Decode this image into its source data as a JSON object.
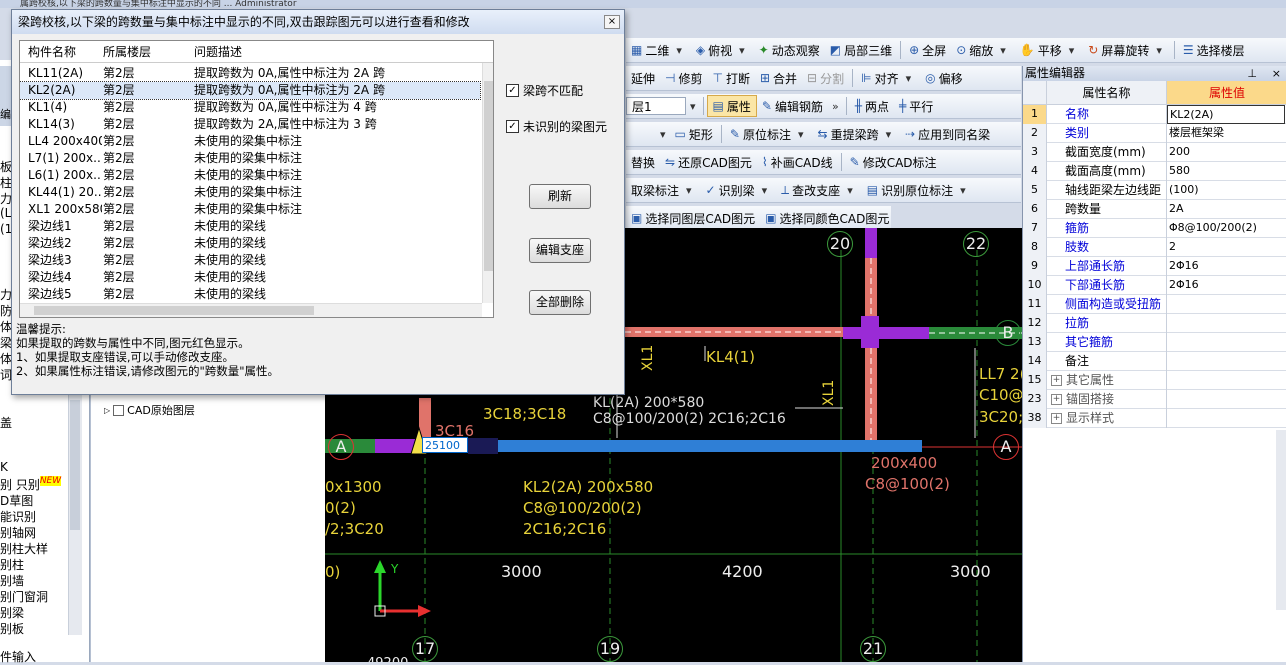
{
  "top_strip": {
    "title": "属跨校核,以下梁的跨数量与集中标注中显示的不同 ... Administrator"
  },
  "toolbar1": {
    "items": [
      "二维",
      "俯视",
      "动态观察",
      "局部三维",
      "全屏",
      "缩放",
      "平移",
      "屏幕旋转",
      "选择楼层"
    ]
  },
  "toolbar2": {
    "items": [
      "延伸",
      "修剪",
      "打断",
      "合并",
      "分割",
      "对齐",
      "偏移"
    ]
  },
  "toolbar3": {
    "floor_select": "层1",
    "items": [
      "属性",
      "编辑钢筋",
      "两点",
      "平行"
    ]
  },
  "toolbar4": {
    "items": [
      "矩形",
      "原位标注",
      "重提梁跨",
      "应用到同名梁"
    ]
  },
  "toolbar5": {
    "items": [
      "替换",
      "还原CAD图元",
      "补画CAD线",
      "修改CAD标注"
    ]
  },
  "toolbar6": {
    "items": [
      "取梁标注",
      "识别梁",
      "查改支座",
      "识别原位标注"
    ]
  },
  "toolbar7": {
    "items": [
      "选择同图层CAD图元",
      "选择同颜色CAD图元"
    ]
  },
  "left_panel": {
    "items": [
      "板",
      "柱",
      "力",
      "(L",
      "(1",
      "力",
      "防",
      "体",
      "梁",
      "体",
      "词",
      "盖",
      "K",
      "别 只别",
      "D草图",
      "能识别",
      "别轴网",
      "别柱大样",
      "别柱",
      "别墙",
      "别门窗洞",
      "别梁",
      "别板",
      "件输入"
    ],
    "new_badge": "NEW",
    "tree_item": "CAD原始图层",
    "edit_tab": "编"
  },
  "dialog": {
    "title": "梁跨校核,以下梁的跨数量与集中标注中显示的不同,双击跟踪图元可以进行查看和修改",
    "columns": [
      "构件名称",
      "所属楼层",
      "问题描述"
    ],
    "rows": [
      {
        "name": "KL11(2A)",
        "floor": "第2层",
        "desc": "提取跨数为 0A,属性中标注为 2A 跨"
      },
      {
        "name": "KL2(2A)",
        "floor": "第2层",
        "desc": "提取跨数为 0A,属性中标注为 2A 跨"
      },
      {
        "name": "KL1(4)",
        "floor": "第2层",
        "desc": "提取跨数为 0A,属性中标注为 4 跨"
      },
      {
        "name": "KL14(3)",
        "floor": "第2层",
        "desc": "提取跨数为 2A,属性中标注为 3 跨"
      },
      {
        "name": "LL4 200x400",
        "floor": "第2层",
        "desc": "未使用的梁集中标注"
      },
      {
        "name": "L7(1) 200x...",
        "floor": "第2层",
        "desc": "未使用的梁集中标注"
      },
      {
        "name": "L6(1) 200x...",
        "floor": "第2层",
        "desc": "未使用的梁集中标注"
      },
      {
        "name": "KL44(1) 20...",
        "floor": "第2层",
        "desc": "未使用的梁集中标注"
      },
      {
        "name": "XL1 200x580",
        "floor": "第2层",
        "desc": "未使用的梁集中标注"
      },
      {
        "name": "梁边线1",
        "floor": "第2层",
        "desc": "未使用的梁线"
      },
      {
        "name": "梁边线2",
        "floor": "第2层",
        "desc": "未使用的梁线"
      },
      {
        "name": "梁边线3",
        "floor": "第2层",
        "desc": "未使用的梁线"
      },
      {
        "name": "梁边线4",
        "floor": "第2层",
        "desc": "未使用的梁线"
      },
      {
        "name": "梁边线5",
        "floor": "第2层",
        "desc": "未使用的梁线"
      }
    ],
    "check_mismatch": "梁跨不匹配",
    "check_unrecognized": "未识别的梁图元",
    "btn_refresh": "刷新",
    "btn_edit_support": "编辑支座",
    "btn_delete_all": "全部删除",
    "tips": [
      "温馨提示:",
      "如果提取的跨数与属性中不同,图元红色显示。",
      "1、如果提取支座错误,可以手动修改支座。",
      "2、如果属性标注错误,请修改图元的\"跨数量\"属性。"
    ]
  },
  "canvas": {
    "grid_top": [
      "20",
      "22"
    ],
    "grid_bottom": [
      "17",
      "19",
      "21"
    ],
    "axis_letters": [
      "A",
      "A",
      "B"
    ],
    "dims": [
      "3000",
      "4200",
      "3000"
    ],
    "labels": {
      "kl4": "KL4(1)",
      "xl1a": "XL1",
      "xl1b": "XL1",
      "c18": "3C18;3C18",
      "c16": "3C16",
      "kl2_a": "KL(2A) 200*580",
      "kl2_b": "C8@100/200(2) 2C16;2C16",
      "input": "25100",
      "kl2_main1": "KL2(2A) 200x580",
      "kl2_main2": "C8@100/200(2)",
      "kl2_main3": "2C16;2C16",
      "left1": "0x1300",
      "left2": "0(2)",
      "left3": "/2;3C20",
      "left4": "0)",
      "b1": "200x400",
      "b2": "C8@100(2)",
      "ll7a": "LL7 2(",
      "ll7b": "C10@",
      "ll7c": "3C20;",
      "bottom_dim": "49200",
      "y_axis": "Y"
    }
  },
  "props": {
    "title": "属性编辑器",
    "header_name": "属性名称",
    "header_value": "属性值",
    "rows": [
      {
        "no": "1",
        "name": "名称",
        "value": "KL2(2A)",
        "blue": true
      },
      {
        "no": "2",
        "name": "类别",
        "value": "楼层框架梁",
        "blue": true
      },
      {
        "no": "3",
        "name": "截面宽度(mm)",
        "value": "200",
        "blue": false
      },
      {
        "no": "4",
        "name": "截面高度(mm)",
        "value": "580",
        "blue": false
      },
      {
        "no": "5",
        "name": "轴线距梁左边线距",
        "value": "(100)",
        "blue": false
      },
      {
        "no": "6",
        "name": "跨数量",
        "value": "2A",
        "blue": false
      },
      {
        "no": "7",
        "name": "箍筋",
        "value": "Φ8@100/200(2)",
        "blue": true
      },
      {
        "no": "8",
        "name": "肢数",
        "value": "2",
        "blue": true
      },
      {
        "no": "9",
        "name": "上部通长筋",
        "value": "2Φ16",
        "blue": true
      },
      {
        "no": "10",
        "name": "下部通长筋",
        "value": "2Φ16",
        "blue": true
      },
      {
        "no": "11",
        "name": "侧面构造或受扭筋",
        "value": "",
        "blue": true
      },
      {
        "no": "12",
        "name": "拉筋",
        "value": "",
        "blue": true
      },
      {
        "no": "13",
        "name": "其它箍筋",
        "value": "",
        "blue": true
      },
      {
        "no": "14",
        "name": "备注",
        "value": "",
        "blue": false
      },
      {
        "no": "15",
        "name": "其它属性",
        "value": "",
        "blue": false,
        "group": true
      },
      {
        "no": "23",
        "name": "锚固搭接",
        "value": "",
        "blue": false,
        "group": true
      },
      {
        "no": "38",
        "name": "显示样式",
        "value": "",
        "blue": false,
        "group": true
      }
    ]
  }
}
